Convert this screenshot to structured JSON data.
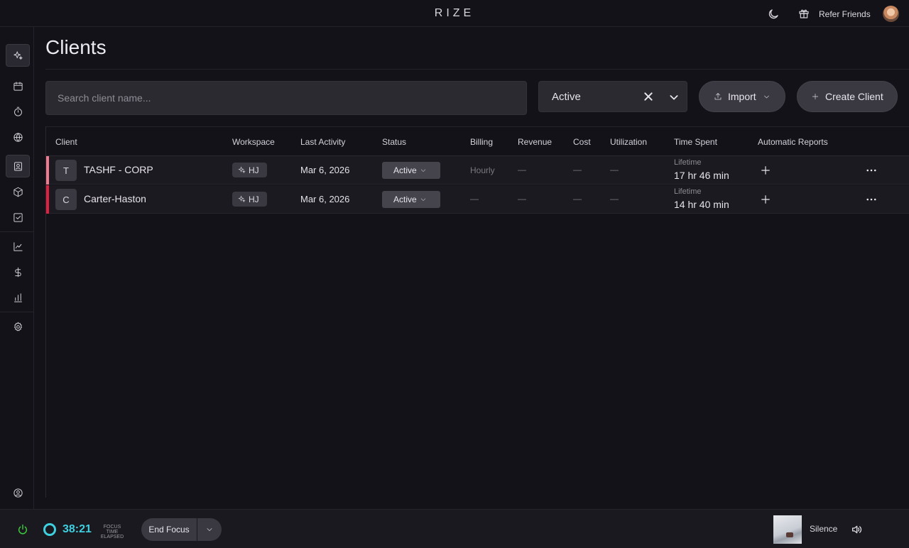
{
  "app": {
    "brand": "RIZE",
    "refer_label": "Refer Friends"
  },
  "sidebar": {
    "items": [
      "sparkle-icon",
      "calendar-icon",
      "stopwatch-icon",
      "globe-icon",
      "contact-icon",
      "box-icon",
      "checkbox-icon",
      "line-chart-icon",
      "dollar-icon",
      "bar-chart-icon",
      "gear-icon",
      "user-circle-icon"
    ],
    "active": "contact-icon"
  },
  "page": {
    "title": "Clients"
  },
  "search": {
    "placeholder": "Search client name..."
  },
  "filter": {
    "value": "Active"
  },
  "buttons": {
    "import_label": "Import",
    "create_label": "Create Client"
  },
  "table": {
    "columns": [
      "Client",
      "Workspace",
      "Last Activity",
      "Status",
      "Billing",
      "Revenue",
      "Cost",
      "Utilization",
      "Time Spent",
      "Automatic Reports"
    ],
    "rows": [
      {
        "initial": "T",
        "name": "TASHF - CORP",
        "accent": "#f07a90",
        "workspace": "HJ",
        "last_activity": "Mar 6, 2026",
        "status": "Active",
        "billing": "Hourly",
        "revenue": "—",
        "cost": "—",
        "utilization": "—",
        "time_label": "Lifetime",
        "time_value": "17 hr 46 min"
      },
      {
        "initial": "C",
        "name": "Carter-Haston",
        "accent": "#e02040",
        "workspace": "HJ",
        "last_activity": "Mar 6, 2026",
        "status": "Active",
        "billing": "—",
        "revenue": "—",
        "cost": "—",
        "utilization": "—",
        "time_label": "Lifetime",
        "time_value": "14 hr 40 min"
      }
    ]
  },
  "focus": {
    "timer": "38:21",
    "label_line1": "FOCUS TIME",
    "label_line2": "ELAPSED",
    "end_label": "End Focus",
    "accent": "#3fd0e0"
  },
  "music": {
    "track": "Silence"
  }
}
